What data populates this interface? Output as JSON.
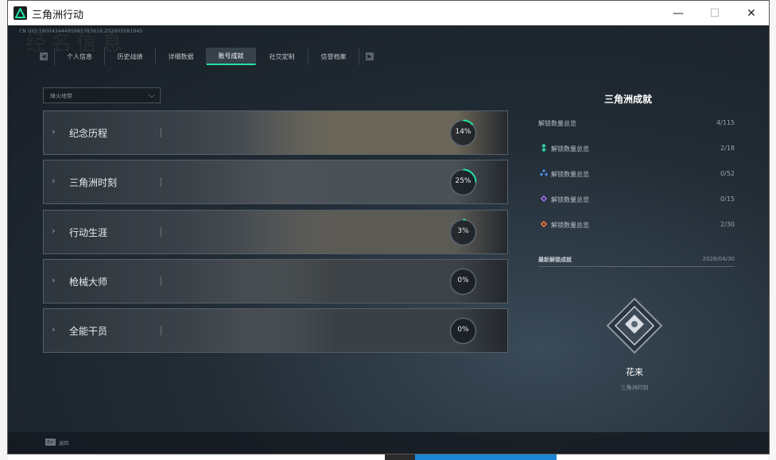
{
  "window": {
    "title": "三角洲行动",
    "minimize": "—",
    "maximize": "☐",
    "close": "✕"
  },
  "uid_text": "CN UID:18004344495965783619,20260508194S",
  "ghost_title": "经名信息",
  "tabs": [
    {
      "label": "个人信息",
      "active": false
    },
    {
      "label": "历史战绩",
      "active": false
    },
    {
      "label": "详细数据",
      "active": false
    },
    {
      "label": "账号成就",
      "active": true
    },
    {
      "label": "社交定制",
      "active": false
    },
    {
      "label": "信誉档案",
      "active": false
    }
  ],
  "dropdown": {
    "label": "烽火地带"
  },
  "categories": [
    {
      "name": "纪念历程",
      "percent": "14%",
      "progress": 0.14
    },
    {
      "name": "三角洲时刻",
      "percent": "25%",
      "progress": 0.25
    },
    {
      "name": "行动生涯",
      "percent": "3%",
      "progress": 0.03
    },
    {
      "name": "枪械大师",
      "percent": "0%",
      "progress": 0.0
    },
    {
      "name": "全能干员",
      "percent": "0%",
      "progress": 0.0
    }
  ],
  "summary": {
    "title": "三角洲成就",
    "overall": {
      "label": "解锁数量总览",
      "value": "4/115"
    },
    "tiers": [
      {
        "label": "解锁数量总览",
        "value": "2/18",
        "icon": "green-diamond-icon",
        "color": "#2ec99a"
      },
      {
        "label": "解锁数量总览",
        "value": "0/52",
        "icon": "blue-diamond-icon",
        "color": "#4a8ee8"
      },
      {
        "label": "解锁数量总览",
        "value": "0/15",
        "icon": "purple-diamond-icon",
        "color": "#9a6ae0"
      },
      {
        "label": "解锁数量总览",
        "value": "2/30",
        "icon": "orange-diamond-icon",
        "color": "#e07a3a"
      }
    ]
  },
  "latest": {
    "header": "最新解锁成就",
    "date": "2026/04/30",
    "badge_name": "花来",
    "badge_category": "三角洲时刻"
  },
  "footer": {
    "esc_key": "Esc",
    "esc_label": "返回"
  },
  "colors": {
    "accent": "#21e3a1"
  }
}
